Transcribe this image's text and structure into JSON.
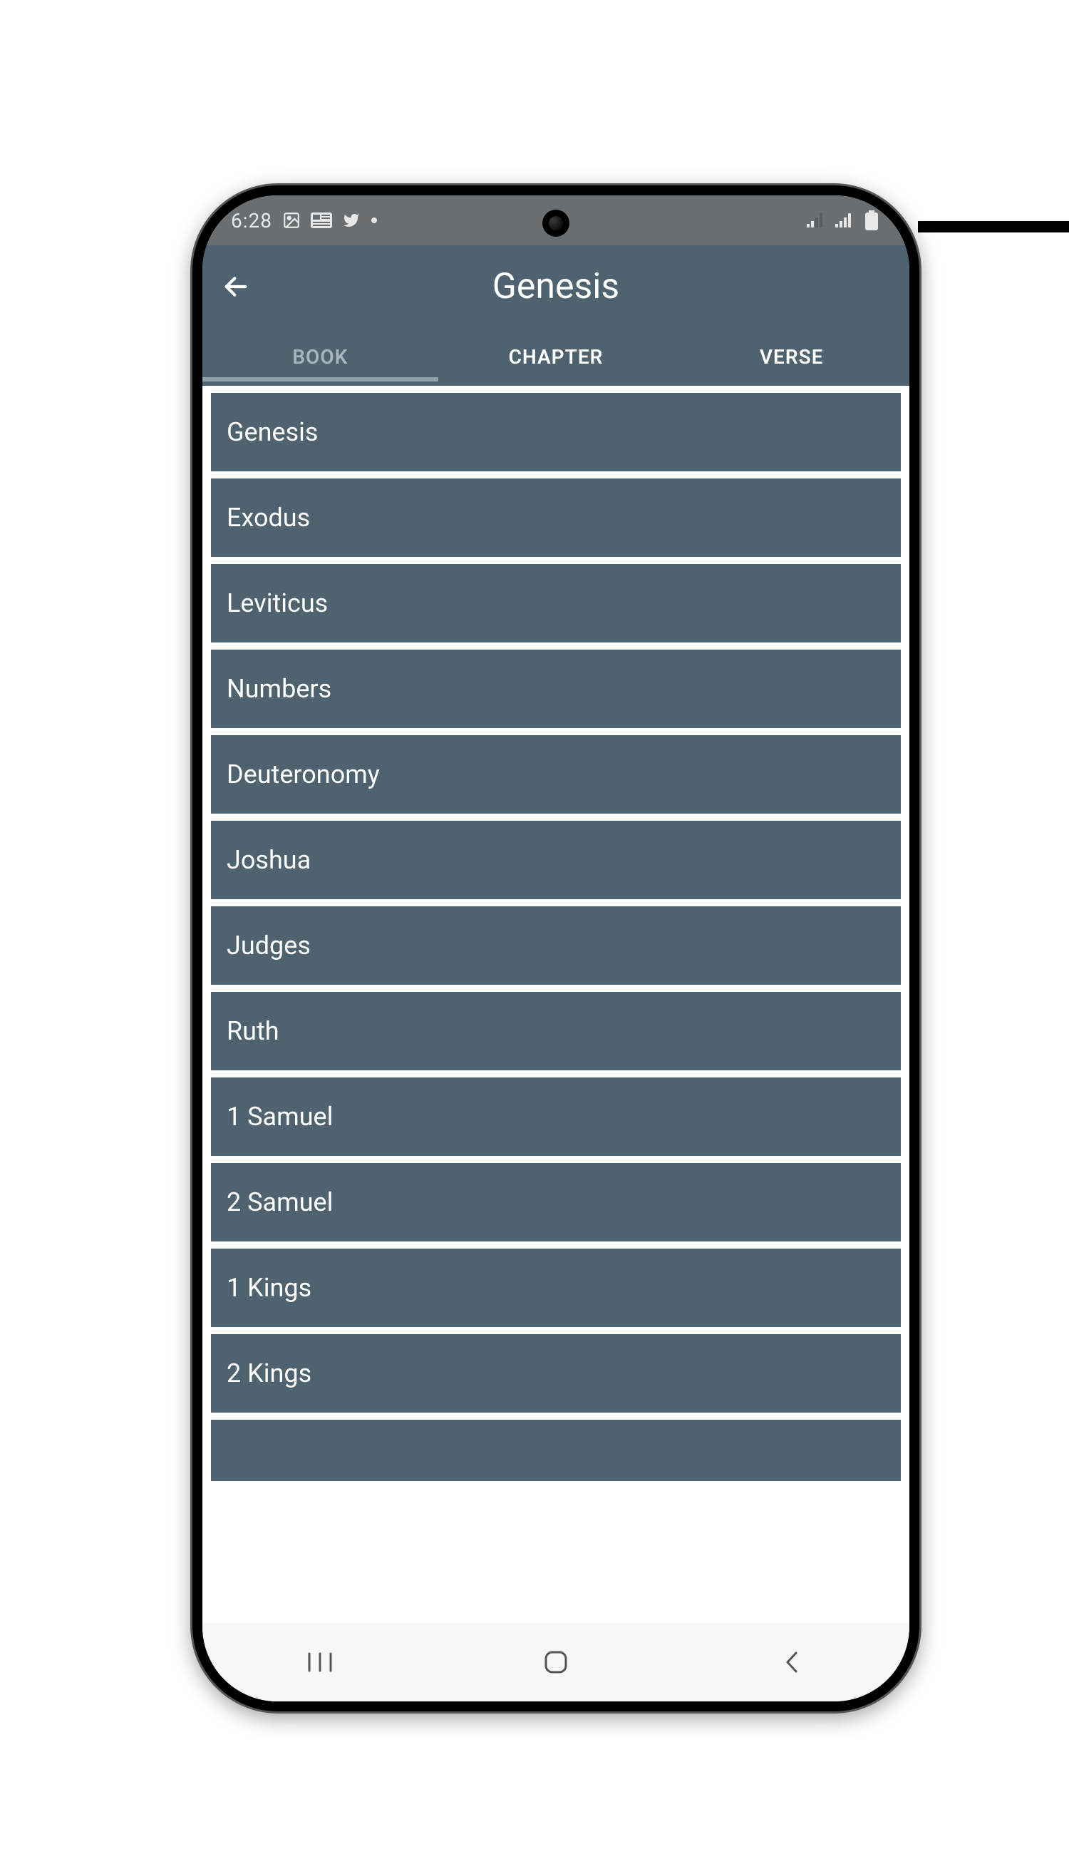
{
  "statusbar": {
    "time": "6:28",
    "icons_left": [
      "image-icon",
      "news-icon",
      "twitter-icon",
      "dot-icon"
    ],
    "icons_right": [
      "signal-weak-icon",
      "signal-icon",
      "battery-icon"
    ]
  },
  "header": {
    "title": "Genesis"
  },
  "tabs": [
    {
      "label": "BOOK",
      "active": true
    },
    {
      "label": "CHAPTER",
      "active": false
    },
    {
      "label": "VERSE",
      "active": false
    }
  ],
  "books": [
    "Genesis",
    "Exodus",
    "Leviticus",
    "Numbers",
    "Deuteronomy",
    "Joshua",
    "Judges",
    "Ruth",
    "1 Samuel",
    "2 Samuel",
    "1 Kings",
    "2 Kings"
  ],
  "colors": {
    "app_bg": "#4e636f",
    "status_bg": "#6b6e70"
  }
}
